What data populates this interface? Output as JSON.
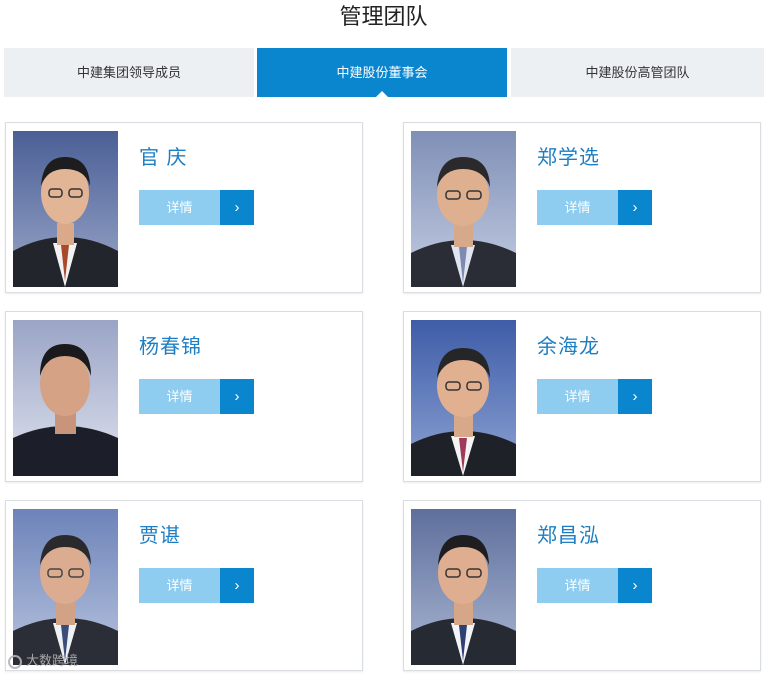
{
  "page_title": "管理团队",
  "tabs": [
    {
      "label": "中建集团领导成员",
      "active": false
    },
    {
      "label": "中建股份董事会",
      "active": true
    },
    {
      "label": "中建股份高管团队",
      "active": false
    }
  ],
  "members": [
    {
      "name": "官 庆",
      "button_label": "详情",
      "arrow": "›"
    },
    {
      "name": "郑学选",
      "button_label": "详情",
      "arrow": "›"
    },
    {
      "name": "杨春锦",
      "button_label": "详情",
      "arrow": "›"
    },
    {
      "name": "余海龙",
      "button_label": "详情",
      "arrow": "›"
    },
    {
      "name": "贾谌",
      "button_label": "详情",
      "arrow": "›"
    },
    {
      "name": "郑昌泓",
      "button_label": "详情",
      "arrow": "›"
    }
  ],
  "watermark": "大数跨境",
  "colors": {
    "accent": "#0a86cf",
    "button_light": "#8fcdf0",
    "name_text": "#1e7ec4",
    "tab_bg": "#ecf0f3"
  }
}
